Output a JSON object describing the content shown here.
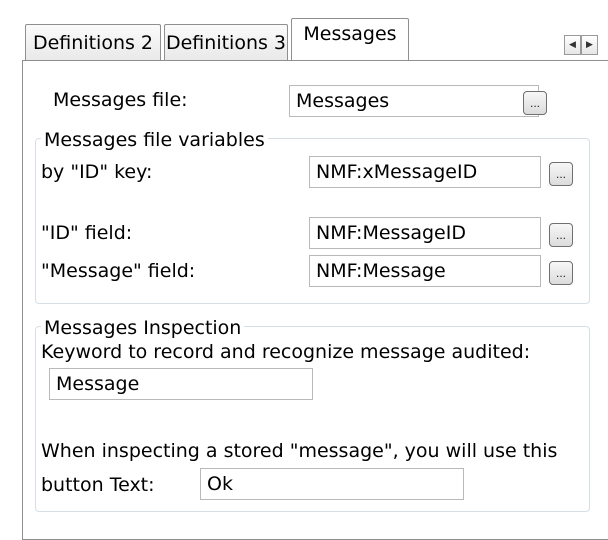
{
  "tabs": [
    {
      "label": "Definitions 2"
    },
    {
      "label": "Definitions 3"
    },
    {
      "label": "Messages"
    }
  ],
  "tab_scroll": {
    "left_icon": "triangle-left-icon",
    "right_icon": "triangle-right-icon"
  },
  "messages_file": {
    "label": "Messages file:",
    "value": "Messages",
    "browse_label": "..."
  },
  "variables_group": {
    "title": "Messages file variables",
    "id_key": {
      "label": "by \"ID\" key:",
      "value": "NMF:xMessageID",
      "browse_label": "..."
    },
    "id_field": {
      "label": "\"ID\" field:",
      "value": "NMF:MessageID",
      "browse_label": "..."
    },
    "message_field": {
      "label": "\"Message\" field:",
      "value": "NMF:Message",
      "browse_label": "..."
    }
  },
  "inspection_group": {
    "title": "Messages Inspection",
    "keyword_label": "Keyword to record and recognize message audited:",
    "keyword_value": "Message",
    "stored_note": "When inspecting a stored \"message\", you will use this",
    "button_text_label": "button Text:",
    "button_text_value": "Ok"
  }
}
